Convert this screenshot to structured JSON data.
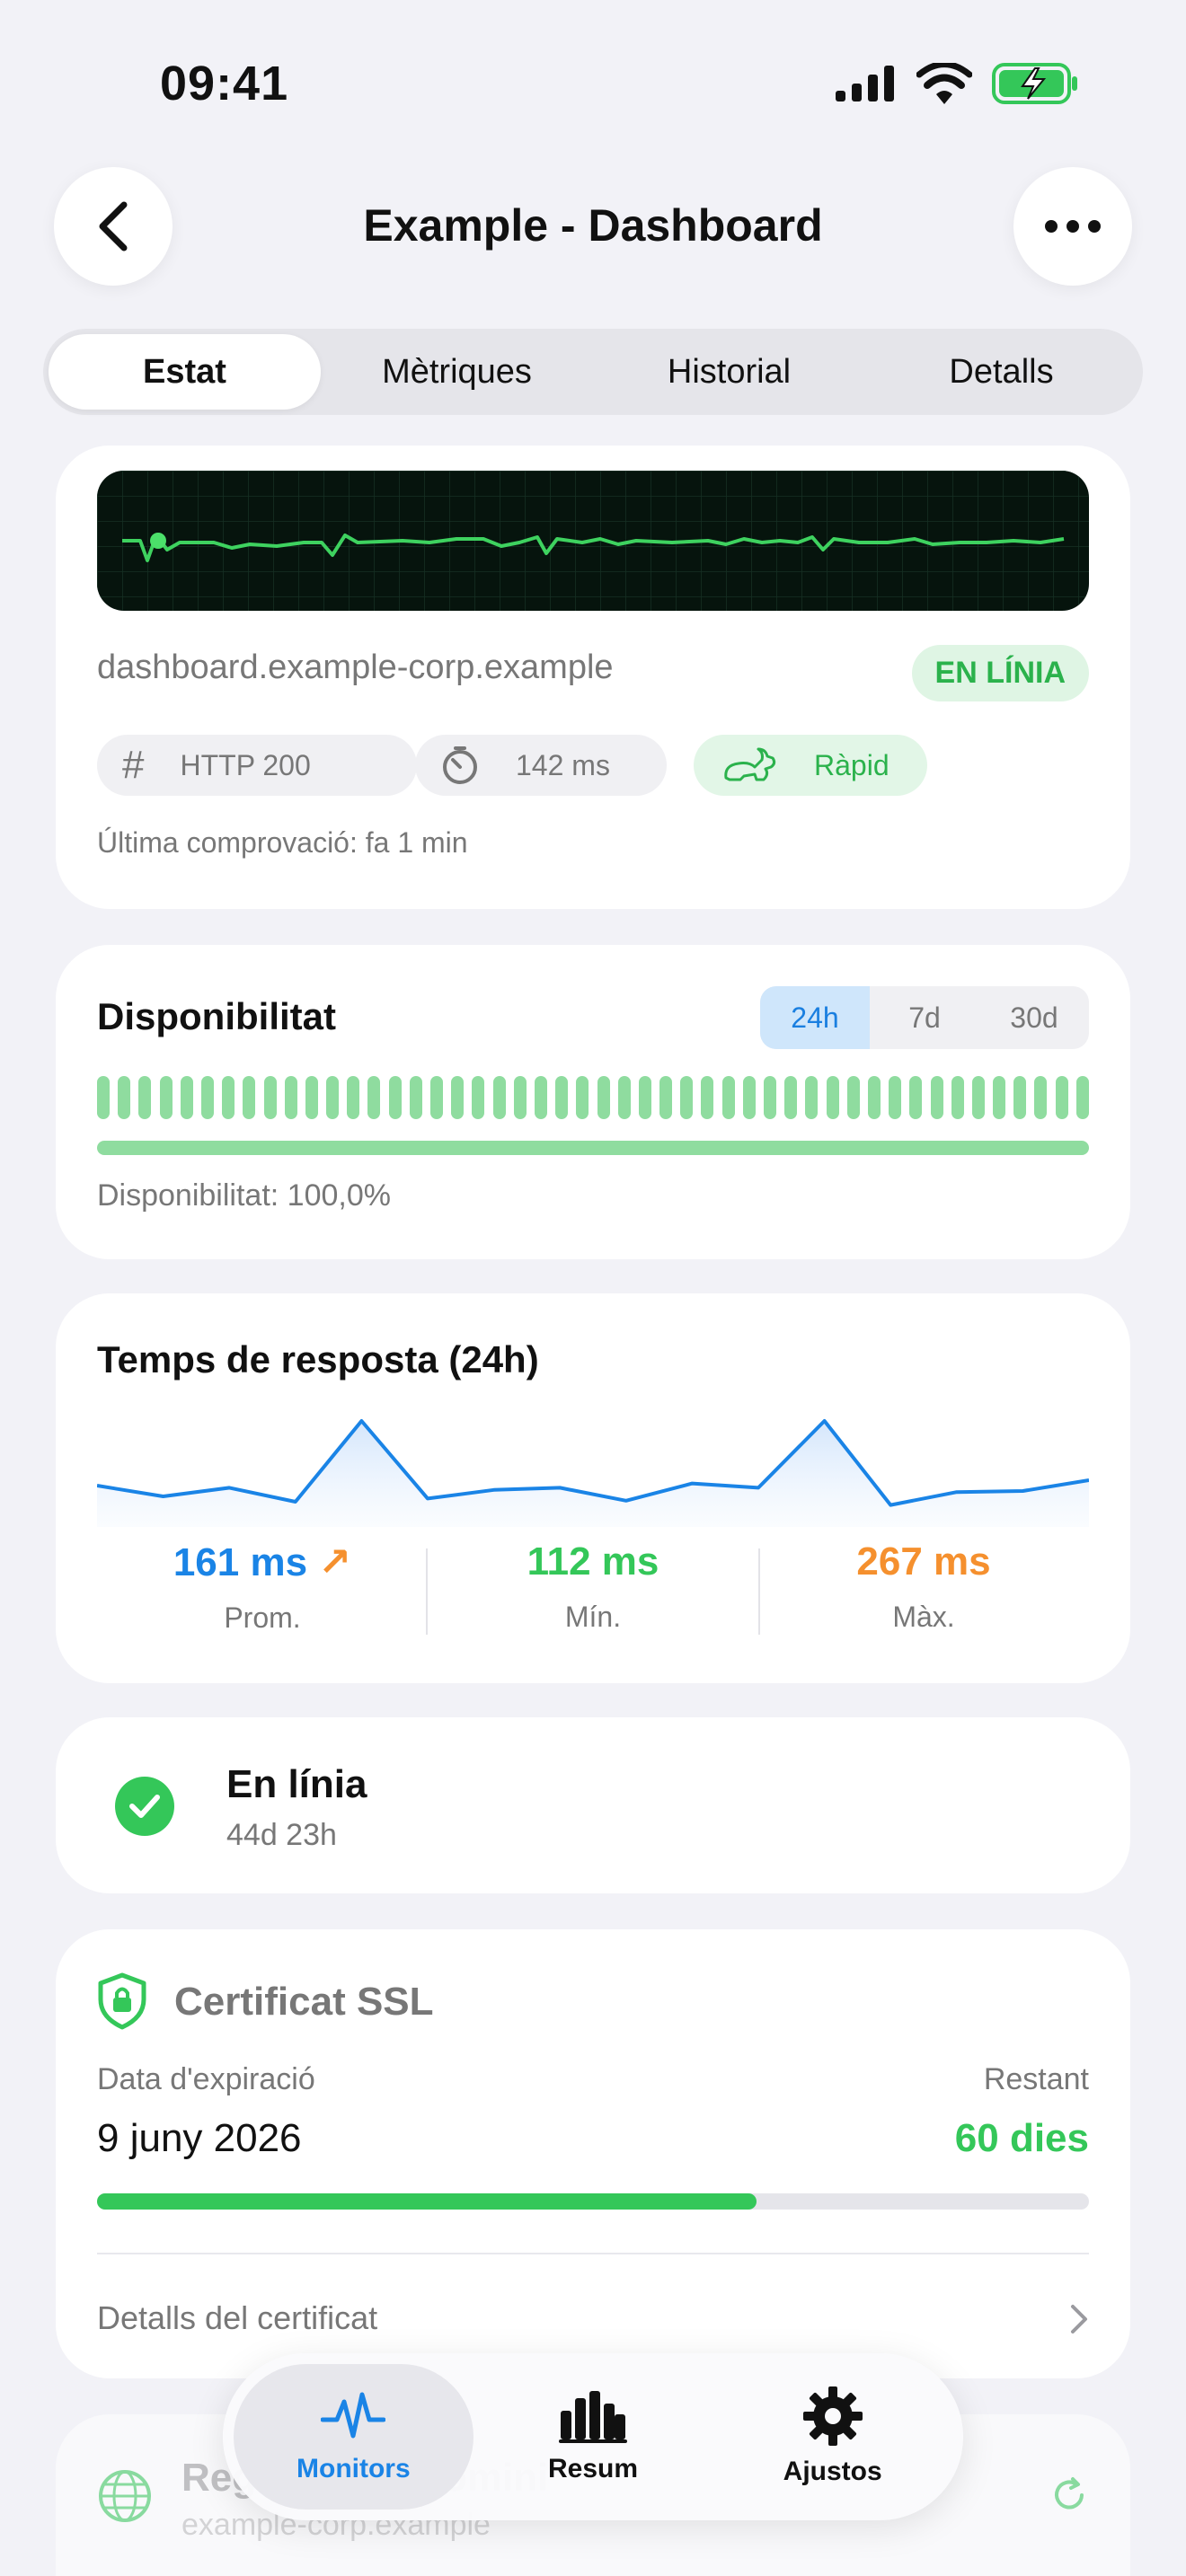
{
  "status_bar": {
    "time": "09:41"
  },
  "header": {
    "title": "Example - Dashboard"
  },
  "tabs": [
    {
      "label": "Estat",
      "active": true
    },
    {
      "label": "Mètriques",
      "active": false
    },
    {
      "label": "Historial",
      "active": false
    },
    {
      "label": "Detalls",
      "active": false
    }
  ],
  "monitor": {
    "domain": "dashboard.example-corp.example",
    "status_badge": "EN LÍNIA",
    "chips": [
      {
        "icon": "hash-icon",
        "label": "HTTP 200"
      },
      {
        "icon": "timer-icon",
        "label": "142 ms"
      },
      {
        "icon": "rabbit-icon",
        "label": "Ràpid"
      }
    ],
    "last_check": "Última comprovació: fa 1 min"
  },
  "availability": {
    "title": "Disponibilitat",
    "ranges": [
      "24h",
      "7d",
      "30d"
    ],
    "active_range": "24h",
    "text": "Disponibilitat: 100,0%",
    "uptime_fraction": 1.0
  },
  "response_time": {
    "title": "Temps de resposta (24h)",
    "series_ms": [
      140,
      130,
      138,
      125,
      200,
      128,
      136,
      138,
      126,
      142,
      138,
      200,
      122,
      134,
      135,
      145
    ],
    "stats": [
      {
        "value": "161 ms",
        "label": "Prom.",
        "color": "#1a84e6",
        "trend": "↗"
      },
      {
        "value": "112 ms",
        "label": "Mín.",
        "color": "#34c759",
        "trend": ""
      },
      {
        "value": "267 ms",
        "label": "Màx.",
        "color": "#f5902e",
        "trend": ""
      }
    ]
  },
  "online_status": {
    "title": "En línia",
    "duration": "44d 23h"
  },
  "ssl": {
    "title": "Certificat SSL",
    "expiry_label": "Data d'expiració",
    "expiry_date": "9 juny 2026",
    "remaining_label": "Restant",
    "remaining_value": "60 dies",
    "remaining_fraction": 0.665,
    "details_link": "Detalls del certificat"
  },
  "registration": {
    "title": "Registre del domini",
    "domain": "example-corp.example"
  },
  "tabbar": [
    {
      "label": "Monitors",
      "icon": "pulse-icon",
      "active": true
    },
    {
      "label": "Resum",
      "icon": "bar-chart-icon",
      "active": false
    },
    {
      "label": "Ajustos",
      "icon": "gear-icon",
      "active": false
    }
  ],
  "colors": {
    "accent": "#1a84e6",
    "success": "#34c759",
    "warning": "#f5902e"
  }
}
